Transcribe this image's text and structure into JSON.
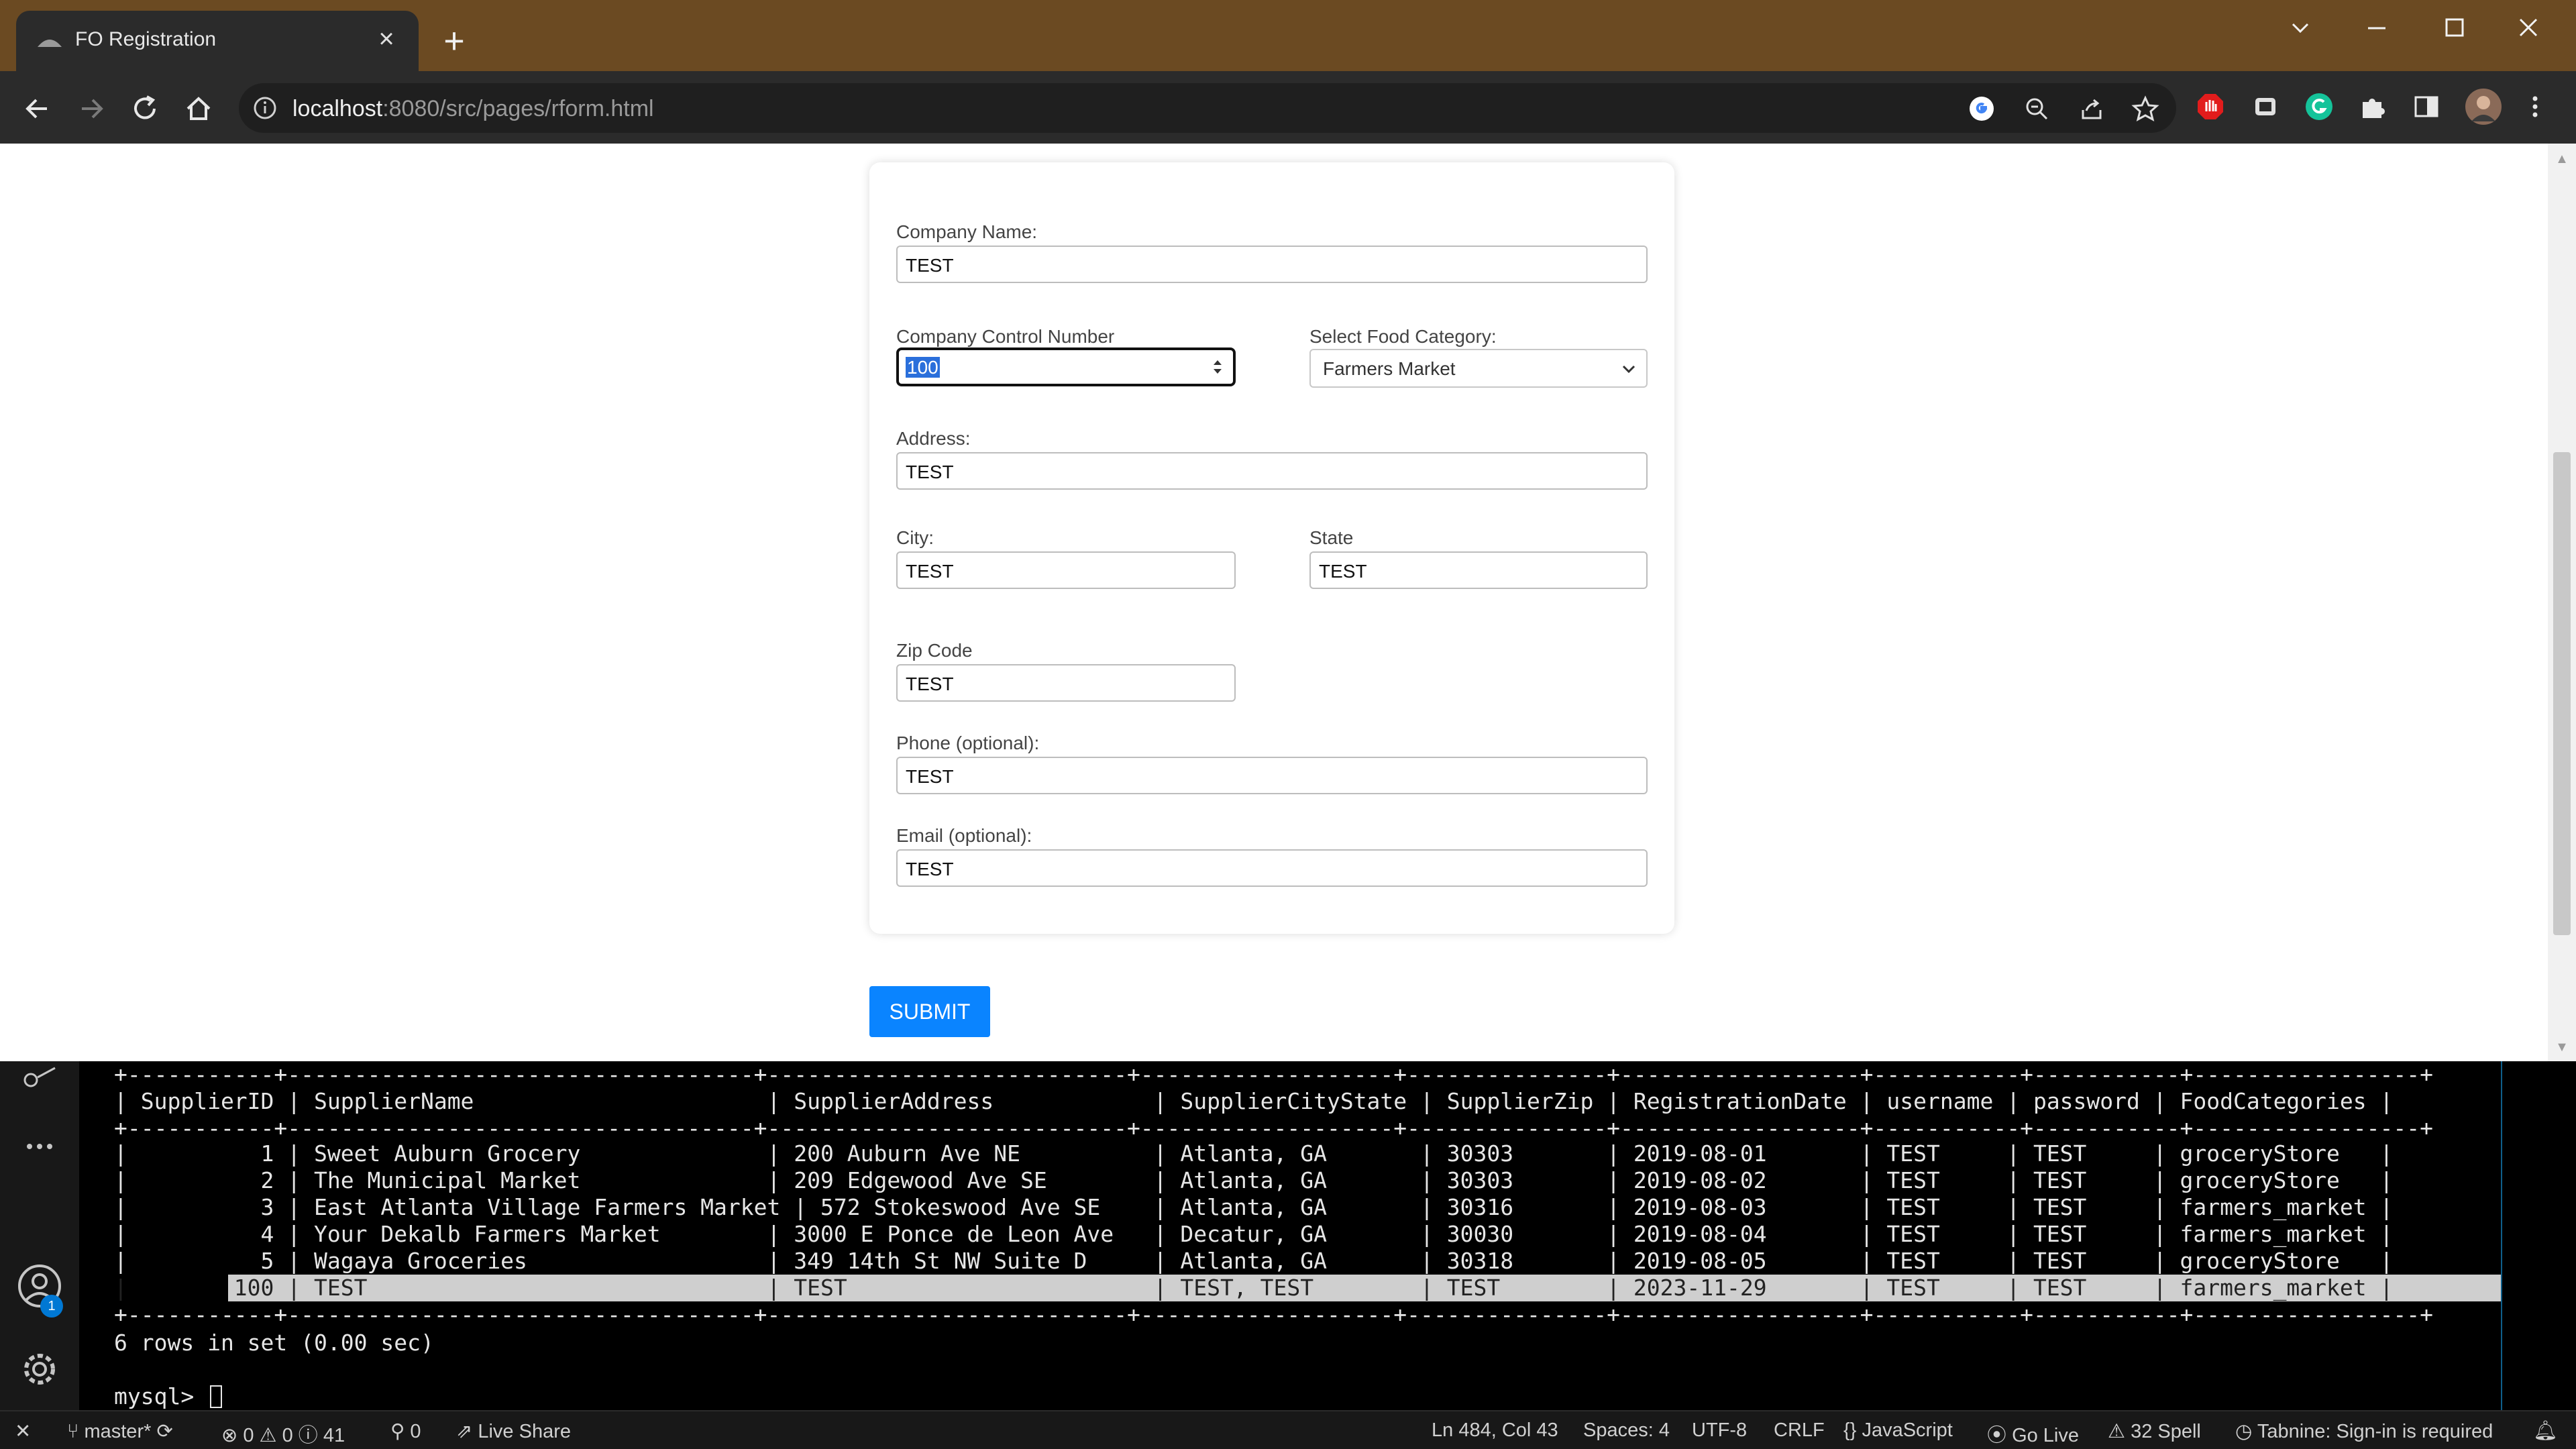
{
  "browser": {
    "tab_title": "FO Registration",
    "tab_close": "×",
    "new_tab": "+",
    "url_host": "localhost",
    "url_rest": ":8080/src/pages/rform.html"
  },
  "form": {
    "company_name_label": "Company Name:",
    "company_name_value": "TEST",
    "ccn_label": "Company Control Number",
    "ccn_value": "100",
    "category_label": "Select Food Category:",
    "category_value": "Farmers Market",
    "address_label": "Address:",
    "address_value": "TEST",
    "city_label": "City:",
    "city_value": "TEST",
    "state_label": "State",
    "state_value": "TEST",
    "zip_label": "Zip Code",
    "zip_value": "TEST",
    "phone_label": "Phone (optional):",
    "phone_value": "TEST",
    "email_label": "Email (optional):",
    "email_value": "TEST",
    "submit_label": "SUBMIT"
  },
  "terminal": {
    "border": "+-----------+-----------------------------------+---------------------------+-------------------+---------------+------------------+-----------+-----------+-----------------+",
    "header": "| SupplierID | SupplierName                      | SupplierAddress            | SupplierCityState | SupplierZip | RegistrationDate | username | password | FoodCategories |",
    "rows": [
      "|          1 | Sweet Auburn Grocery              | 200 Auburn Ave NE          | Atlanta, GA       | 30303       | 2019-08-01       | TEST     | TEST     | groceryStore   |",
      "|          2 | The Municipal Market              | 209 Edgewood Ave SE        | Atlanta, GA       | 30303       | 2019-08-02       | TEST     | TEST     | groceryStore   |",
      "|          3 | East Atlanta Village Farmers Market | 572 Stokeswood Ave SE    | Atlanta, GA       | 30316       | 2019-08-03       | TEST     | TEST     | farmers_market |",
      "|          4 | Your Dekalb Farmers Market        | 3000 E Ponce de Leon Ave   | Decatur, GA       | 30030       | 2019-08-04       | TEST     | TEST     | farmers_market |",
      "|          5 | Wagaya Groceries                  | 349 14th St NW Suite D     | Atlanta, GA       | 30318       | 2019-08-05       | TEST     | TEST     | groceryStore   |"
    ],
    "highlight_row": "|        100 | TEST                              | TEST                       | TEST, TEST        | TEST        | 2023-11-29       | TEST     | TEST     | farmers_market |",
    "summary": "6 rows in set (0.00 sec)",
    "prompt": "mysql> "
  },
  "activity": {
    "account_badge": "1"
  },
  "statusbar": {
    "branch": "master*",
    "problems": "⊗ 0 ⚠ 0 ⓘ 41",
    "ports": "0",
    "live_share": "Live Share",
    "position": "Ln 484, Col 43",
    "spaces": "Spaces: 4",
    "encoding": "UTF-8",
    "eol": "CRLF",
    "language": "JavaScript",
    "go_live": "Go Live",
    "spell": "32 Spell",
    "tabnine": "Tabnine: Sign-in is required"
  }
}
